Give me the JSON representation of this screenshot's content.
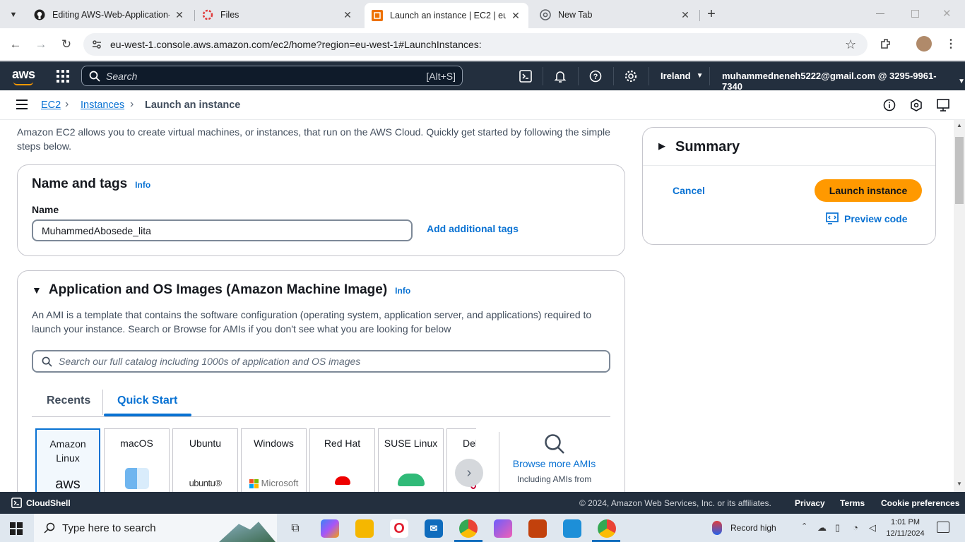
{
  "browser": {
    "tabs": [
      {
        "title": "Editing AWS-Web-Application-H",
        "close": "✕"
      },
      {
        "title": "Files",
        "close": "✕"
      },
      {
        "title": "Launch an instance | EC2 | eu-w",
        "close": "✕"
      },
      {
        "title": "New Tab",
        "close": "✕"
      }
    ],
    "new_tab": "+",
    "url": "eu-west-1.console.aws.amazon.com/ec2/home?region=eu-west-1#LaunchInstances:"
  },
  "aws_nav": {
    "logo": "aws",
    "search_placeholder": "Search",
    "search_shortcut": "[Alt+S]",
    "region": "Ireland",
    "account": "muhammedneneh5222@gmail.com @ 3295-9961-7340"
  },
  "breadcrumb": {
    "items": [
      "EC2",
      "Instances",
      "Launch an instance"
    ]
  },
  "intro": "Amazon EC2 allows you to create virtual machines, or instances, that run on the AWS Cloud. Quickly get started by following the simple steps below.",
  "name_tags": {
    "title": "Name and tags",
    "info": "Info",
    "label": "Name",
    "value": "MuhammedAbosede_lita",
    "add_tags": "Add additional tags"
  },
  "ami": {
    "title": "Application and OS Images (Amazon Machine Image)",
    "info": "Info",
    "description": "An AMI is a template that contains the software configuration (operating system, application server, and applications) required to launch your instance. Search or Browse for AMIs if you don't see what you are looking for below",
    "search_placeholder": "Search our full catalog including 1000s of application and OS images",
    "tabs": [
      "Recents",
      "Quick Start"
    ],
    "active_tab": "Quick Start",
    "options": [
      {
        "name": "Amazon Linux",
        "logo": "aws"
      },
      {
        "name": "macOS",
        "logo": "finder-icon"
      },
      {
        "name": "Ubuntu",
        "logo": "ubuntu®"
      },
      {
        "name": "Windows",
        "logo": "Microsoft"
      },
      {
        "name": "Red Hat",
        "logo": "redhat-icon"
      },
      {
        "name": "SUSE Linux",
        "logo": "suse-icon"
      },
      {
        "name": "Del",
        "logo": "debian-icon"
      }
    ],
    "browse_more": "Browse more AMIs",
    "browse_sub": "Including AMIs from AWS, Marketplace and"
  },
  "summary": {
    "title": "Summary",
    "cancel": "Cancel",
    "launch": "Launch instance",
    "preview": "Preview code"
  },
  "footer": {
    "cloudshell": "CloudShell",
    "copyright": "© 2024, Amazon Web Services, Inc. or its affiliates.",
    "links": [
      "Privacy",
      "Terms",
      "Cookie preferences"
    ]
  },
  "taskbar": {
    "search": "Type here to search",
    "weather": "Record high",
    "time": "1:01 PM",
    "date": "12/11/2024"
  },
  "colors": {
    "aws_nav": "#232f3e",
    "link": "#0972d3",
    "launch_button": "#ff9900"
  }
}
